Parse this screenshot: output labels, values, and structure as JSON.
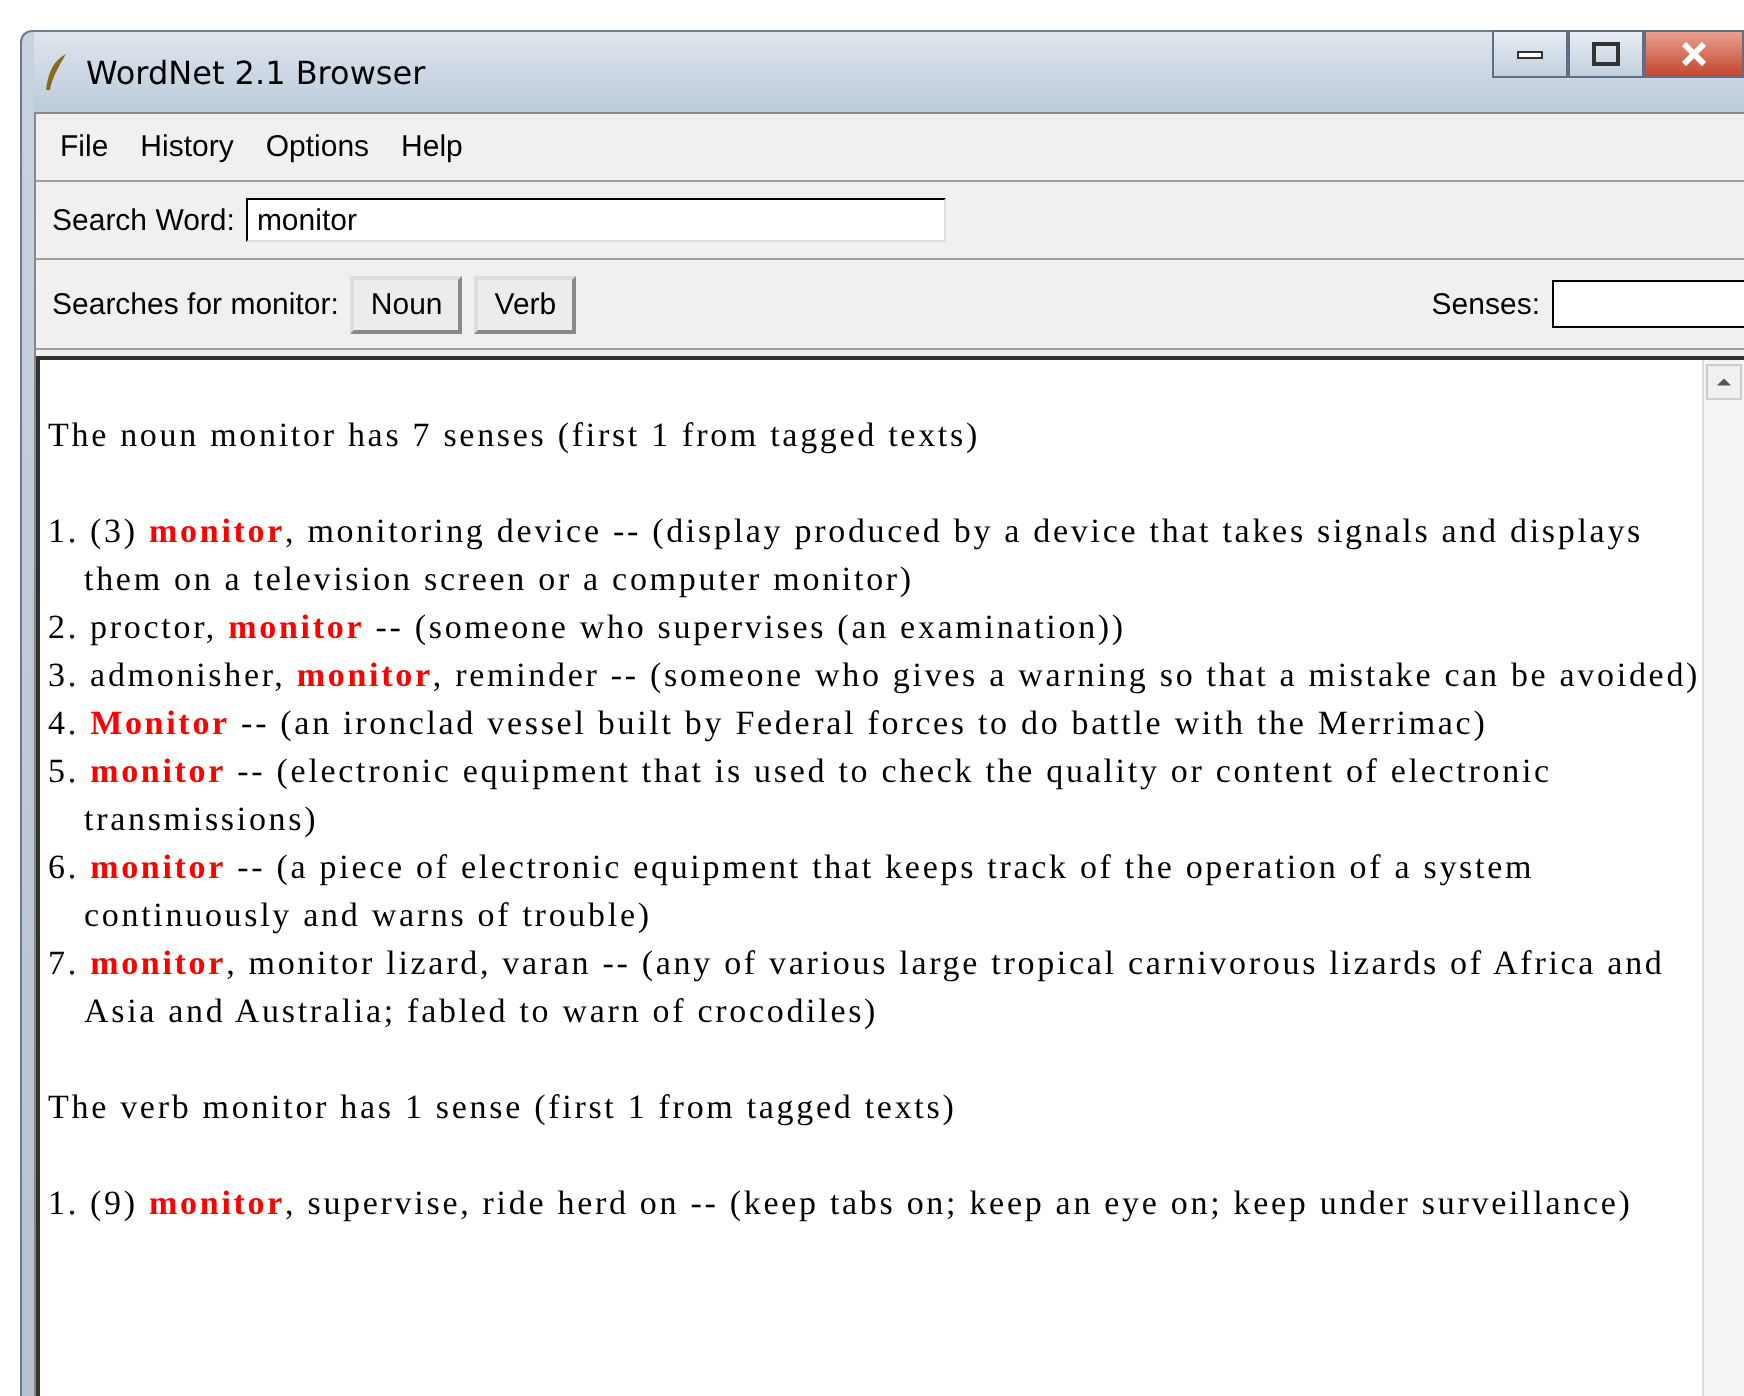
{
  "window": {
    "title": "WordNet 2.1 Browser"
  },
  "menu": [
    "File",
    "History",
    "Options",
    "Help"
  ],
  "search": {
    "label": "Search Word:",
    "value": "monitor"
  },
  "searches": {
    "label": "Searches for monitor:",
    "buttons": [
      "Noun",
      "Verb"
    ],
    "senses_label": "Senses:"
  },
  "results": [
    {
      "kind": "heading",
      "text": "The noun monitor has 7 senses (first 1 from tagged texts)"
    },
    {
      "kind": "sense",
      "text": "1. (3) **monitor**, monitoring device -- (display produced by a device that takes signals and displays them on a television screen or a computer monitor)"
    },
    {
      "kind": "sense",
      "text": "2. proctor, **monitor** -- (someone who supervises (an examination))"
    },
    {
      "kind": "sense",
      "text": "3. admonisher, **monitor**, reminder -- (someone who gives a warning so that a mistake can be avoided)"
    },
    {
      "kind": "sense",
      "text": "4. **Monitor** -- (an ironclad vessel built by Federal forces to do battle with the Merrimac)"
    },
    {
      "kind": "sense",
      "text": "5. **monitor** -- (electronic equipment that is used to check the quality or content of electronic transmissions)"
    },
    {
      "kind": "sense",
      "text": "6. **monitor** -- (a piece of electronic equipment that keeps track of the operation of a system continuously and warns of trouble)"
    },
    {
      "kind": "sense",
      "text": "7. **monitor**, monitor lizard, varan -- (any of various large tropical carnivorous lizards of Africa and Asia and Australia; fabled to warn of crocodiles)"
    },
    {
      "kind": "heading",
      "text": "The verb monitor has 1 sense (first 1 from tagged texts)"
    },
    {
      "kind": "sense",
      "text": "1. (9) **monitor**, supervise, ride herd on -- (keep tabs on; keep an eye on; keep under surveillance)"
    }
  ]
}
